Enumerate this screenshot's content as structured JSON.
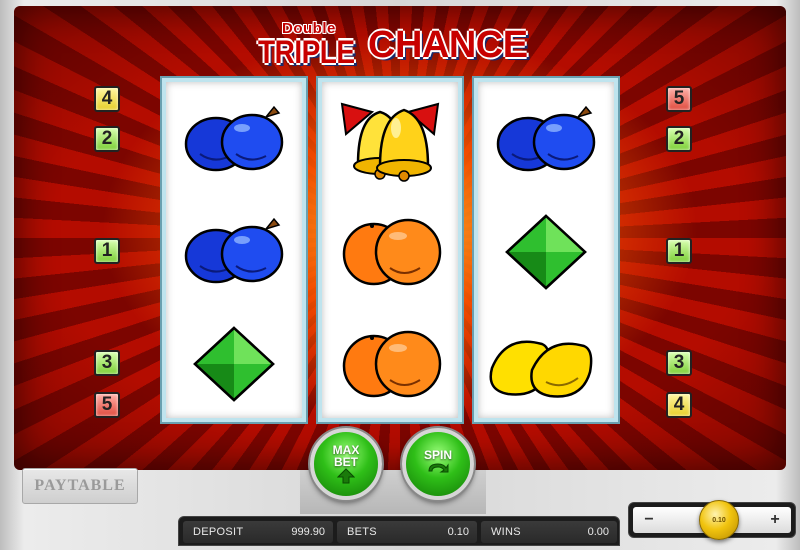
{
  "game": {
    "title_small": "Double",
    "title_left": "TRIPLE",
    "title_right": "CHANCE"
  },
  "lines": {
    "left": [
      "4",
      "2",
      "1",
      "3",
      "5"
    ],
    "right": [
      "5",
      "2",
      "1",
      "3",
      "4"
    ]
  },
  "reels": [
    {
      "symbols": [
        "plum",
        "plum",
        "diamond"
      ]
    },
    {
      "symbols": [
        "bell",
        "orange",
        "orange"
      ]
    },
    {
      "symbols": [
        "plum",
        "diamond",
        "lemon"
      ]
    }
  ],
  "buttons": {
    "paytable": "PAYTABLE",
    "maxbet_line1": "MAX",
    "maxbet_line2": "BET",
    "spin": "SPIN"
  },
  "status": {
    "deposit_label": "DEPOSIT",
    "deposit_value": "999.90",
    "bets_label": "BETS",
    "bets_value": "0.10",
    "wins_label": "WINS",
    "wins_value": "0.00"
  },
  "stake": {
    "minus": "−",
    "plus": "+",
    "coin_value": "0.10"
  }
}
